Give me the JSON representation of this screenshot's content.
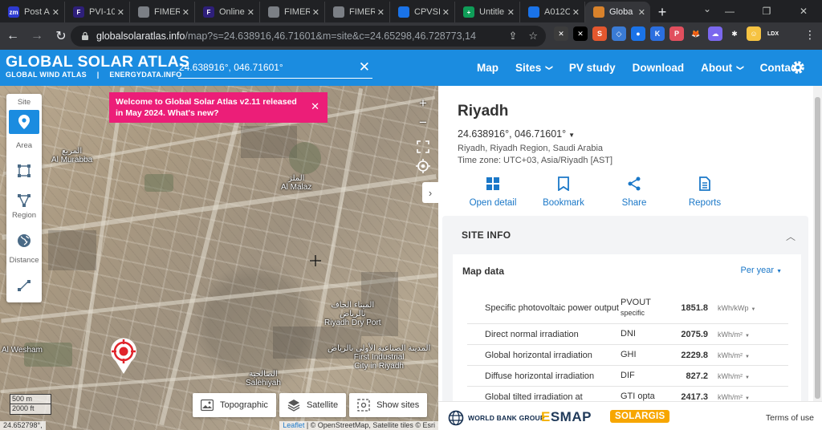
{
  "browser": {
    "tabs": [
      {
        "label": "Post A",
        "favicon_text": "zm",
        "favicon_color": "#2d3ad1",
        "active": false
      },
      {
        "label": "PVI-10",
        "favicon_text": "F",
        "favicon_color": "#2e1f7a",
        "active": false
      },
      {
        "label": "FIMER",
        "favicon_text": "",
        "favicon_color": "#7b7f85",
        "active": false
      },
      {
        "label": "Online",
        "favicon_text": "F",
        "favicon_color": "#2e1f7a",
        "active": false
      },
      {
        "label": "FIMER",
        "favicon_text": "",
        "favicon_color": "#7b7f85",
        "active": false
      },
      {
        "label": "FIMER",
        "favicon_text": "",
        "favicon_color": "#7b7f85",
        "active": false
      },
      {
        "label": "CPVSI",
        "favicon_text": "",
        "favicon_color": "#1a73e8",
        "active": false
      },
      {
        "label": "Untitle",
        "favicon_text": "+",
        "favicon_color": "#0f9d58",
        "active": false
      },
      {
        "label": "A012C",
        "favicon_text": "",
        "favicon_color": "#1a73e8",
        "active": false
      },
      {
        "label": "Globa",
        "favicon_text": "",
        "favicon_color": "#d9822b",
        "active": true
      }
    ],
    "url_host": "globalsolaratlas.info",
    "url_path": "/map?s=24.638916,46.71601&m=site&c=24.65298,46.728773,14",
    "extensions": [
      {
        "name": "ext-1",
        "text": "✕",
        "color": "#3c3c3c"
      },
      {
        "name": "ext-2",
        "text": "✕",
        "color": "#000000"
      },
      {
        "name": "ext-3",
        "text": "S",
        "color": "#e4572e"
      },
      {
        "name": "ext-4",
        "text": "◇",
        "color": "#3a7bd5"
      },
      {
        "name": "ext-5",
        "text": "●",
        "color": "#1a73e8"
      },
      {
        "name": "ext-6",
        "text": "K",
        "color": "#2b6fe0"
      },
      {
        "name": "ext-7",
        "text": "P",
        "color": "#e14f5e"
      },
      {
        "name": "ext-8",
        "text": "🦊",
        "color": "#35363a"
      },
      {
        "name": "ext-9",
        "text": "☁",
        "color": "#7b68ee"
      },
      {
        "name": "ext-10",
        "text": "✱",
        "color": "#35363a"
      },
      {
        "name": "ext-11",
        "text": "☺",
        "color": "#f6c342"
      },
      {
        "name": "ext-12",
        "text": "LDX",
        "color": "#35363a"
      }
    ]
  },
  "site": {
    "brand_title": "GLOBAL SOLAR ATLAS",
    "brand_sub_1": "GLOBAL WIND ATLAS",
    "brand_sub_2": "ENERGYDATA.INFO",
    "search_value": "24.638916°, 046.71601°",
    "nav": [
      {
        "label": "Map",
        "has_menu": false
      },
      {
        "label": "Sites",
        "has_menu": true
      },
      {
        "label": "PV study",
        "has_menu": false
      },
      {
        "label": "Download",
        "has_menu": false
      },
      {
        "label": "About",
        "has_menu": true
      },
      {
        "label": "Contact",
        "has_menu": false
      }
    ],
    "accent_color": "#1b8ce0"
  },
  "map": {
    "tools": {
      "site_label": "Site",
      "area_label": "Area",
      "region_label": "Region",
      "distance_label": "Distance"
    },
    "welcome_text": "Welcome to Global Solar Atlas v2.11 released in May 2024. What's new?",
    "welcome_color": "#ec1e78",
    "labels": [
      {
        "name": "al-murabba",
        "text": "المربع\nAl Murabba"
      },
      {
        "name": "al-malaz",
        "text": "الملز\nAl Malaz"
      },
      {
        "name": "riyadh-dry-port",
        "text": "الميناء الجاف\nبالرياض\nRiyadh Dry Port"
      },
      {
        "name": "al-wesham",
        "text": "Al Wesham"
      },
      {
        "name": "first-industrial-city",
        "text": "المدينة الصناعية الأولى بالرياض\nFirst Industrial\nCity in Riyadh"
      },
      {
        "name": "salehiyah",
        "text": "الصالحية\nSalehiyah"
      }
    ],
    "layers": {
      "topographic": "Topographic",
      "satellite": "Satellite",
      "show_sites": "Show sites"
    },
    "scale_top": "500 m",
    "scale_bottom": "2000 ft",
    "coord_readout": "24.652798°,",
    "attrib_leaflet": "Leaflet",
    "attrib_rest": " | © OpenStreetMap, Satellite tiles © Esri"
  },
  "panel": {
    "city": "Riyadh",
    "coords": "24.638916°, 046.71601°",
    "address": "Riyadh, Riyadh Region, Saudi Arabia",
    "timezone": "Time zone: UTC+03, Asia/Riyadh [AST]",
    "actions": {
      "open_detail": "Open detail",
      "bookmark": "Bookmark",
      "share": "Share",
      "reports": "Reports"
    },
    "site_info_title": "SITE INFO",
    "map_data_title": "Map data",
    "per_year": "Per year",
    "rows": [
      {
        "name": "Specific photovoltaic power output",
        "abbr": "PVOUT",
        "abbr_sub": "specific",
        "value": "1851.8",
        "unit": "kWh/kWp"
      },
      {
        "name": "Direct normal irradiation",
        "abbr": "DNI",
        "abbr_sub": "",
        "value": "2075.9",
        "unit": "kWh/m²"
      },
      {
        "name": "Global horizontal irradiation",
        "abbr": "GHI",
        "abbr_sub": "",
        "value": "2229.8",
        "unit": "kWh/m²"
      },
      {
        "name": "Diffuse horizontal irradiation",
        "abbr": "DIF",
        "abbr_sub": "",
        "value": "827.2",
        "unit": "kWh/m²"
      },
      {
        "name": "Global tilted irradiation at",
        "abbr": "GTI opta",
        "abbr_sub": "",
        "value": "2417.3",
        "unit": "kWh/m²"
      }
    ]
  },
  "footer": {
    "world_bank": "WORLD BANK GROUP",
    "esmap_e": "E",
    "esmap_rest": "SMAP",
    "solargis": "SOLARGIS",
    "terms": "Terms of use"
  }
}
